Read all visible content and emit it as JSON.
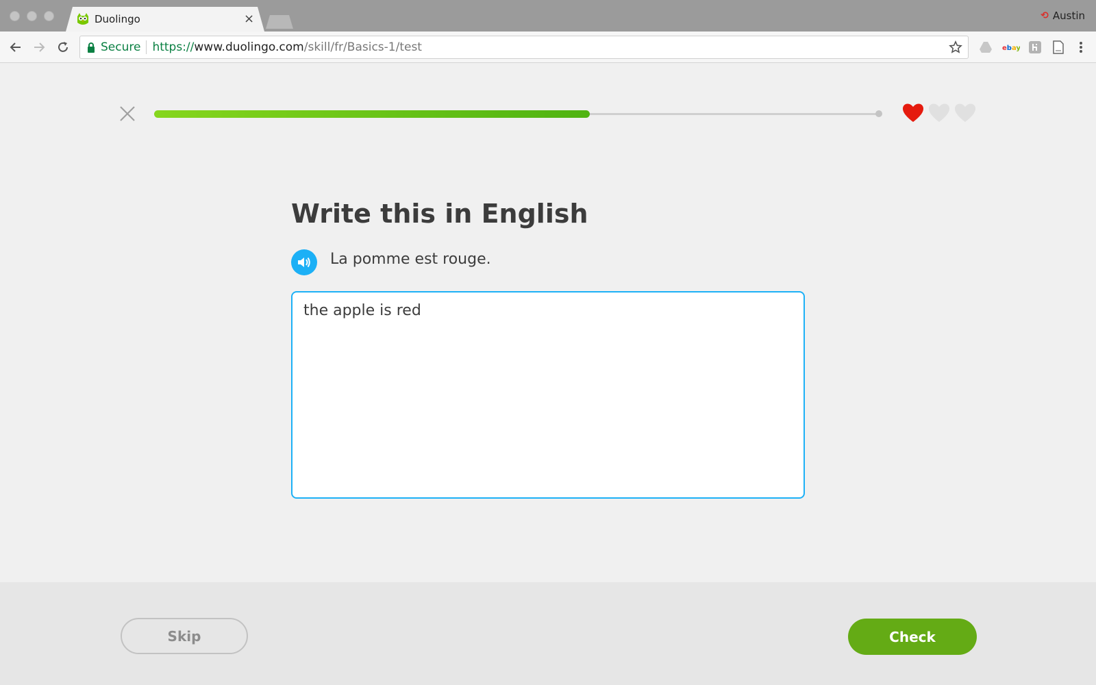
{
  "browser": {
    "tab_title": "Duolingo",
    "tab_close": "×",
    "profile_name": "Austin",
    "secure_label": "Secure",
    "url_scheme": "https://",
    "url_host": "www.duolingo.com",
    "url_path": "/skill/fr/Basics-1/test"
  },
  "lesson": {
    "progress": 0.6,
    "hearts_total": 3,
    "hearts_full": 1,
    "prompt": "Write this in English",
    "sentence": "La pomme est rouge.",
    "answer_value": "the apple is red"
  },
  "footer": {
    "skip_label": "Skip",
    "check_label": "Check"
  },
  "colors": {
    "accent_blue": "#1cb0f6",
    "progress_green": "#58b911",
    "check_green": "#64ab15",
    "heart_red": "#e51b0e",
    "heart_empty": "#e0e0e0"
  },
  "icons": [
    "owl-icon",
    "close-icon",
    "back-icon",
    "forward-icon",
    "reload-icon",
    "lock-icon",
    "star-icon",
    "drive-icon",
    "ebay-icon",
    "extension-icon",
    "document-icon",
    "menu-icon",
    "quit-icon",
    "heart-icon",
    "speaker-icon"
  ]
}
